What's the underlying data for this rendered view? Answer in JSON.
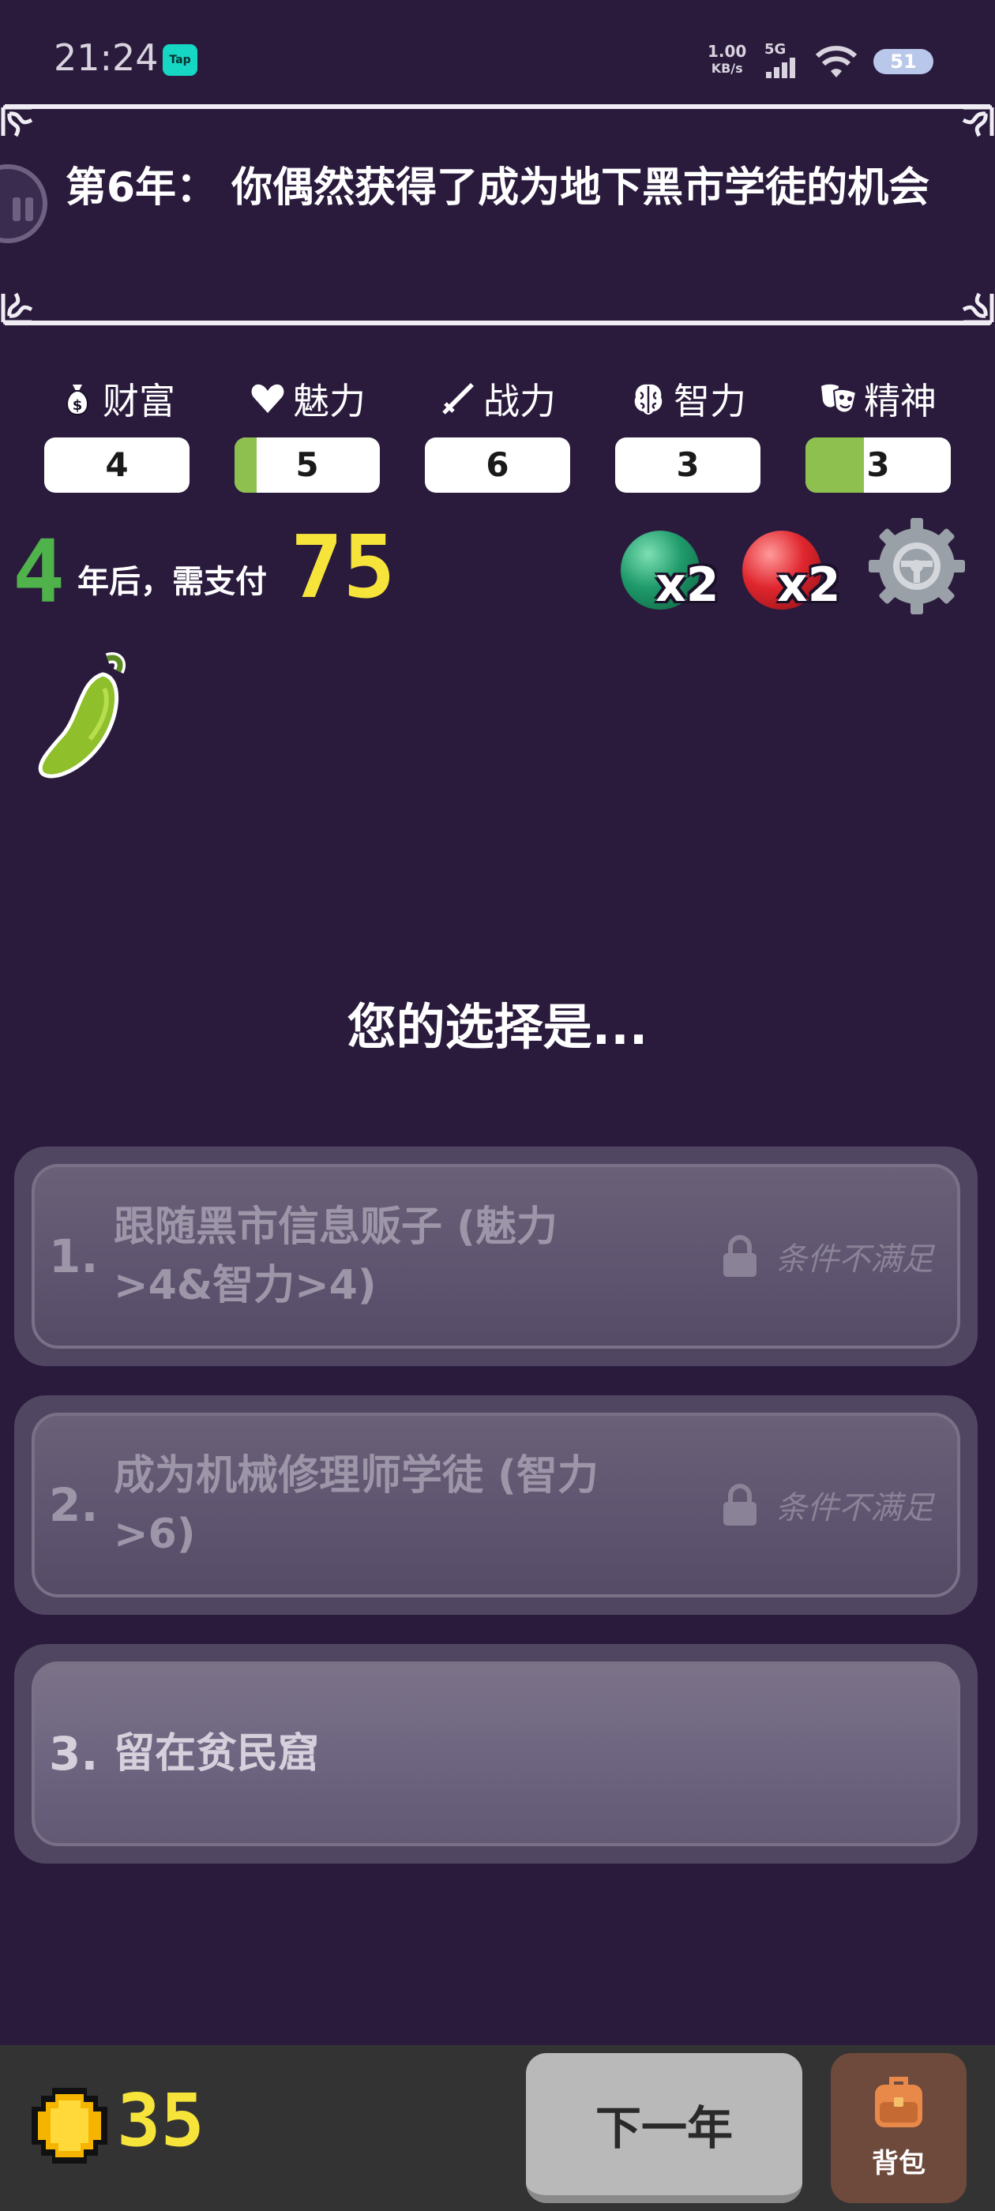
{
  "status_bar": {
    "time": "21:24",
    "app_badge": "Tap",
    "net_speed": "1.00",
    "net_unit": "KB/s",
    "signal": "5G",
    "battery": "51"
  },
  "event": {
    "title": "第6年： 你偶然获得了成为地下黑市学徒的机会"
  },
  "stats": [
    {
      "key": "wealth",
      "label": "财富",
      "icon": "money-bag-icon",
      "value": "4",
      "fill": 0
    },
    {
      "key": "charm",
      "label": "魅力",
      "icon": "heart-icon",
      "value": "5",
      "fill": 0.15
    },
    {
      "key": "combat",
      "label": "战力",
      "icon": "sword-icon",
      "value": "6",
      "fill": 0
    },
    {
      "key": "intelligence",
      "label": "智力",
      "icon": "brain-icon",
      "value": "3",
      "fill": 0
    },
    {
      "key": "spirit",
      "label": "精神",
      "icon": "masks-icon",
      "value": "3",
      "fill": 0.4
    }
  ],
  "payment": {
    "years": "4",
    "text": "年后，需支付",
    "amount": "75"
  },
  "orbs": [
    {
      "color": "#1f9a6a",
      "icon": "green-orb-icon",
      "count": "x2"
    },
    {
      "color": "#e0262e",
      "icon": "red-orb-icon",
      "count": "x2"
    }
  ],
  "choices_prompt": "您的选择是...",
  "choices": [
    {
      "num": "1.",
      "text": "跟随黑市信息贩子 (魅力>4&智力>4)",
      "locked": true,
      "lock_text": "条件不满足"
    },
    {
      "num": "2.",
      "text": "成为机械修理师学徒 (智力>6)",
      "locked": true,
      "lock_text": "条件不满足"
    },
    {
      "num": "3.",
      "text": "留在贫民窟",
      "locked": false,
      "lock_text": ""
    }
  ],
  "bottom": {
    "coins": "35",
    "next_label": "下一年",
    "bag_label": "背包"
  },
  "colors": {
    "background": "#2a1b3d",
    "stat_fill": "#8dc04f",
    "years_green": "#4fb24a",
    "gold": "#f7e43a"
  }
}
